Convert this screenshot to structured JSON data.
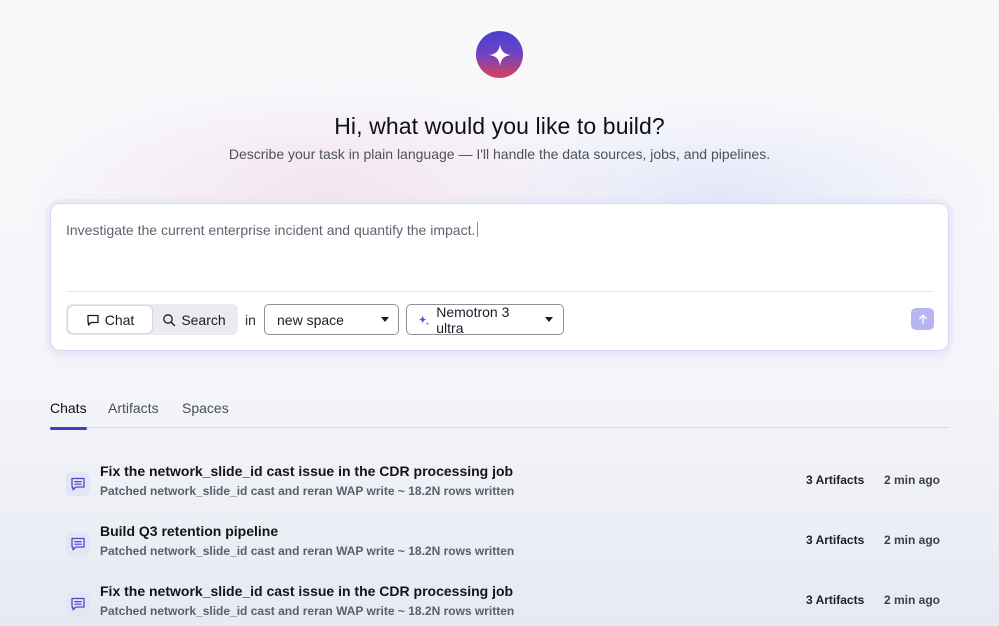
{
  "hero": {
    "title": "Hi, what would you like to build?",
    "subtitle": "Describe your task in plain language — I'll handle the data sources, jobs, and pipelines."
  },
  "prompt": {
    "value": "Investigate the current enterprise incident and quantify the impact.",
    "mode_chat": "Chat",
    "mode_search": "Search",
    "in_label": "in",
    "space_value": "new space",
    "model_value": "Nemotron 3 ultra"
  },
  "tabs": [
    {
      "label": "Chats",
      "active": true
    },
    {
      "label": "Artifacts",
      "active": false
    },
    {
      "label": "Spaces",
      "active": false
    }
  ],
  "chats": [
    {
      "title": "Fix the network_slide_id cast issue in the CDR processing job",
      "subtitle": "Patched network_slide_id cast and reran WAP write ~ 18.2N rows written",
      "artifacts": "3 Artifacts",
      "time": "2 min ago"
    },
    {
      "title": "Build Q3 retention pipeline",
      "subtitle": "Patched network_slide_id cast and reran WAP write ~ 18.2N rows written",
      "artifacts": "3 Artifacts",
      "time": "2 min ago"
    },
    {
      "title": "Fix the network_slide_id cast issue in the CDR processing job",
      "subtitle": "Patched network_slide_id cast and reran WAP write ~ 18.2N rows written",
      "artifacts": "3 Artifacts",
      "time": "2 min ago"
    }
  ],
  "colors": {
    "accent": "#3f3cc6",
    "send_button": "#b7b6f2",
    "chat_icon": "#4a47c8"
  },
  "icons": {
    "logo": "sparkle-icon",
    "chat_mode": "speech-bubble-icon",
    "search_mode": "search-icon",
    "model": "sparkle-icon",
    "send": "arrow-up-icon",
    "chat_row": "message-lines-icon"
  }
}
